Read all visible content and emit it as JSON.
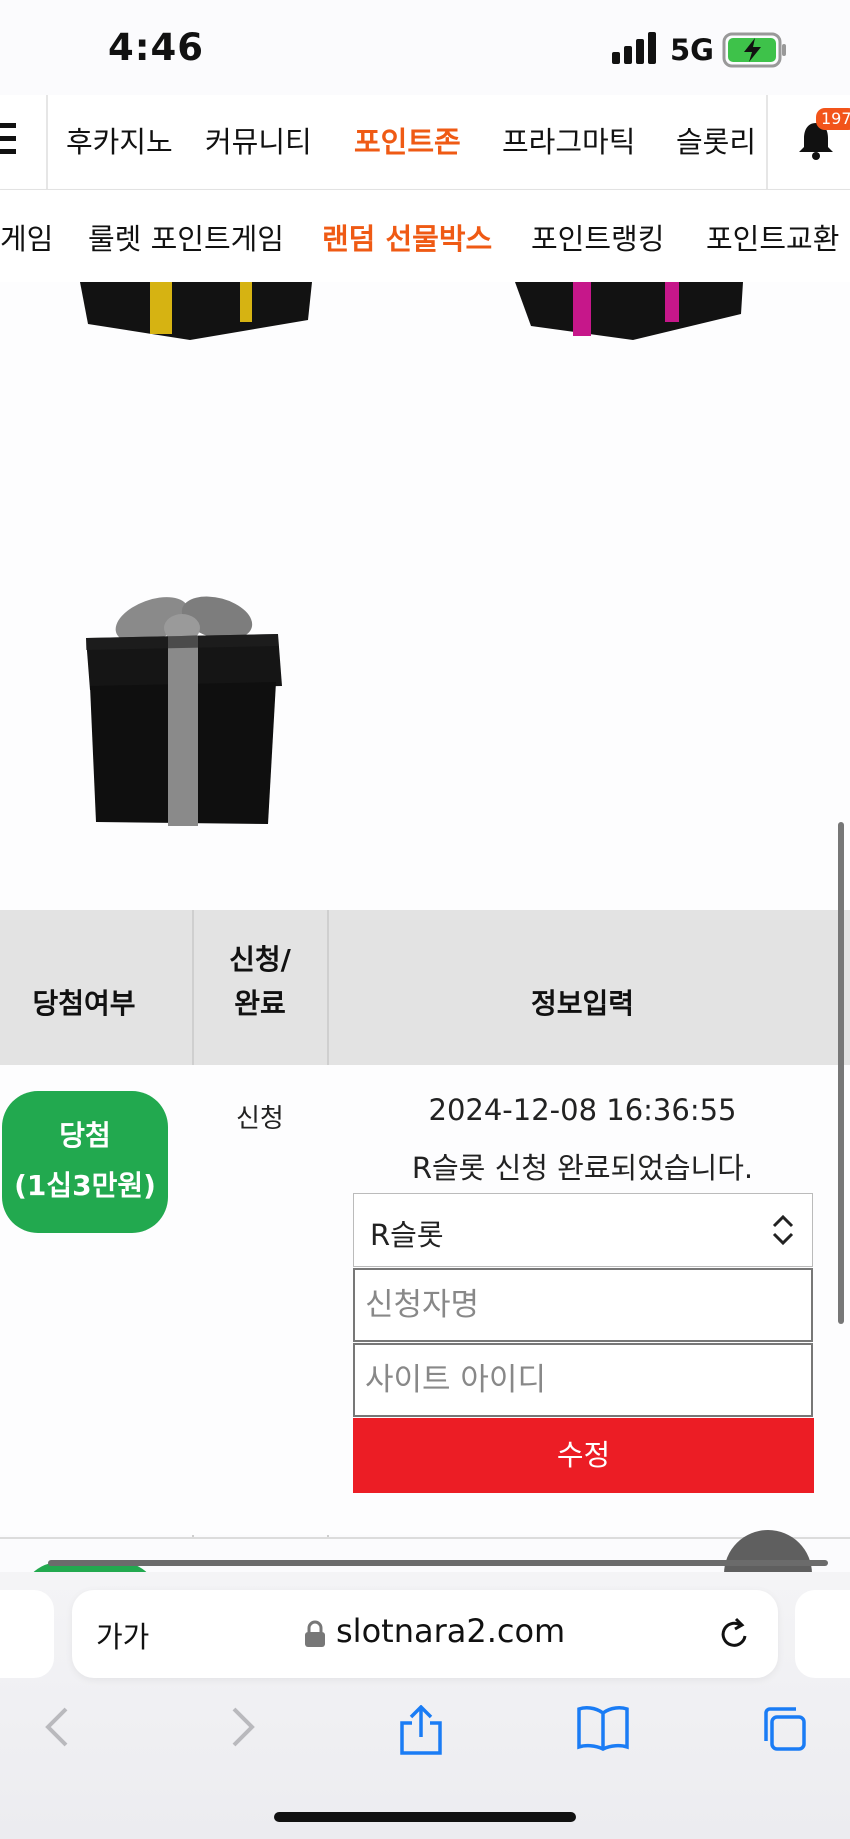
{
  "status_bar": {
    "time": "4:46",
    "network": "5G"
  },
  "nav_top": {
    "notification_count": "197",
    "items": [
      {
        "label": "후카지노",
        "active": false
      },
      {
        "label": "커뮤니티",
        "active": false
      },
      {
        "label": "포인트존",
        "active": true
      },
      {
        "label": "프라그마틱",
        "active": false
      },
      {
        "label": "슬롯리",
        "active": false
      }
    ]
  },
  "nav_sub": {
    "items": [
      {
        "label": "게임",
        "active": false
      },
      {
        "label": "룰렛 포인트게임",
        "active": false
      },
      {
        "label": "랜덤 선물박스",
        "active": true
      },
      {
        "label": "포인트랭킹",
        "active": false
      },
      {
        "label": "포인트교환",
        "active": false
      }
    ]
  },
  "colors": {
    "accent": "#ef5a14",
    "win_green": "#22a94f",
    "submit_red": "#ec1d25",
    "ribbon_yellow": "#d6b312",
    "ribbon_pink": "#c6178a",
    "ribbon_gray": "#8a8a8a"
  },
  "table": {
    "headers": {
      "result": "당첨여부",
      "apply_line1": "신청/",
      "apply_line2": "완료",
      "info": "정보입력"
    },
    "row": {
      "result_line1": "당첨",
      "result_line2": "(1십3만원)",
      "status": "신청",
      "datetime": "2024-12-08 16:36:55",
      "message": "R슬롯 신청 완료되었습니다.",
      "site_select": "R슬롯",
      "name_placeholder": "신청자명",
      "id_placeholder": "사이트 아이디",
      "submit_label": "수정"
    }
  },
  "browser": {
    "text_size_label": "가가",
    "url": "slotnara2.com"
  }
}
